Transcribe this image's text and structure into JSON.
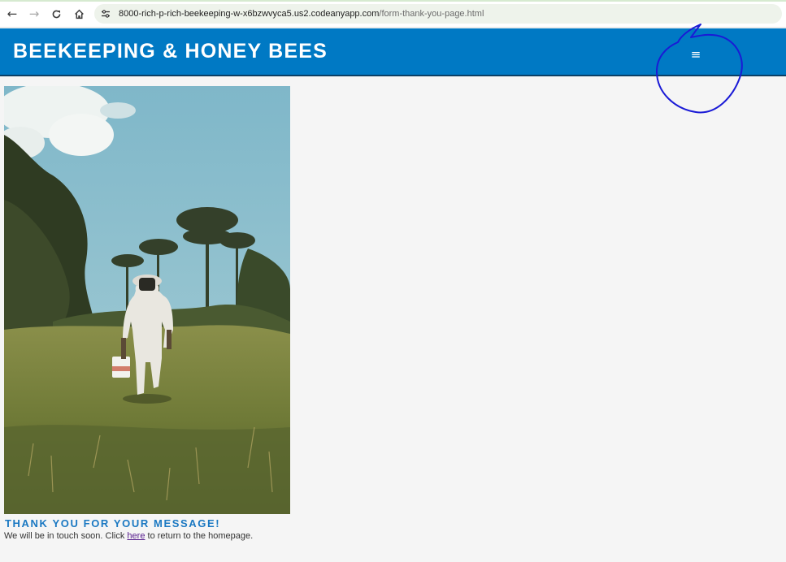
{
  "browser": {
    "back_icon": "arrow-left-icon",
    "forward_icon": "arrow-right-icon",
    "reload_icon": "reload-icon",
    "home_icon": "home-icon",
    "site_info_icon": "tune-icon",
    "url_host": "8000-rich-p-rich-beekeeping-w-x6bzwvyca5.us2.codeanyapp.com",
    "url_path": "/form-thank-you-page.html"
  },
  "header": {
    "title": "BEEKEEPING & HONEY BEES",
    "menu_icon": "hamburger-menu-icon",
    "background": "#0079c4"
  },
  "hero": {
    "image": "beekeeper-walking-in-field-photo"
  },
  "message": {
    "heading": "THANK YOU FOR YOUR MESSAGE!",
    "text_before": "We will be in touch soon. Click ",
    "link_text": "here",
    "text_after": " to return to the homepage.",
    "heading_color": "#1a78c2"
  },
  "annotation": {
    "color": "#1a1ad6",
    "shape": "hand-drawn-circle"
  }
}
